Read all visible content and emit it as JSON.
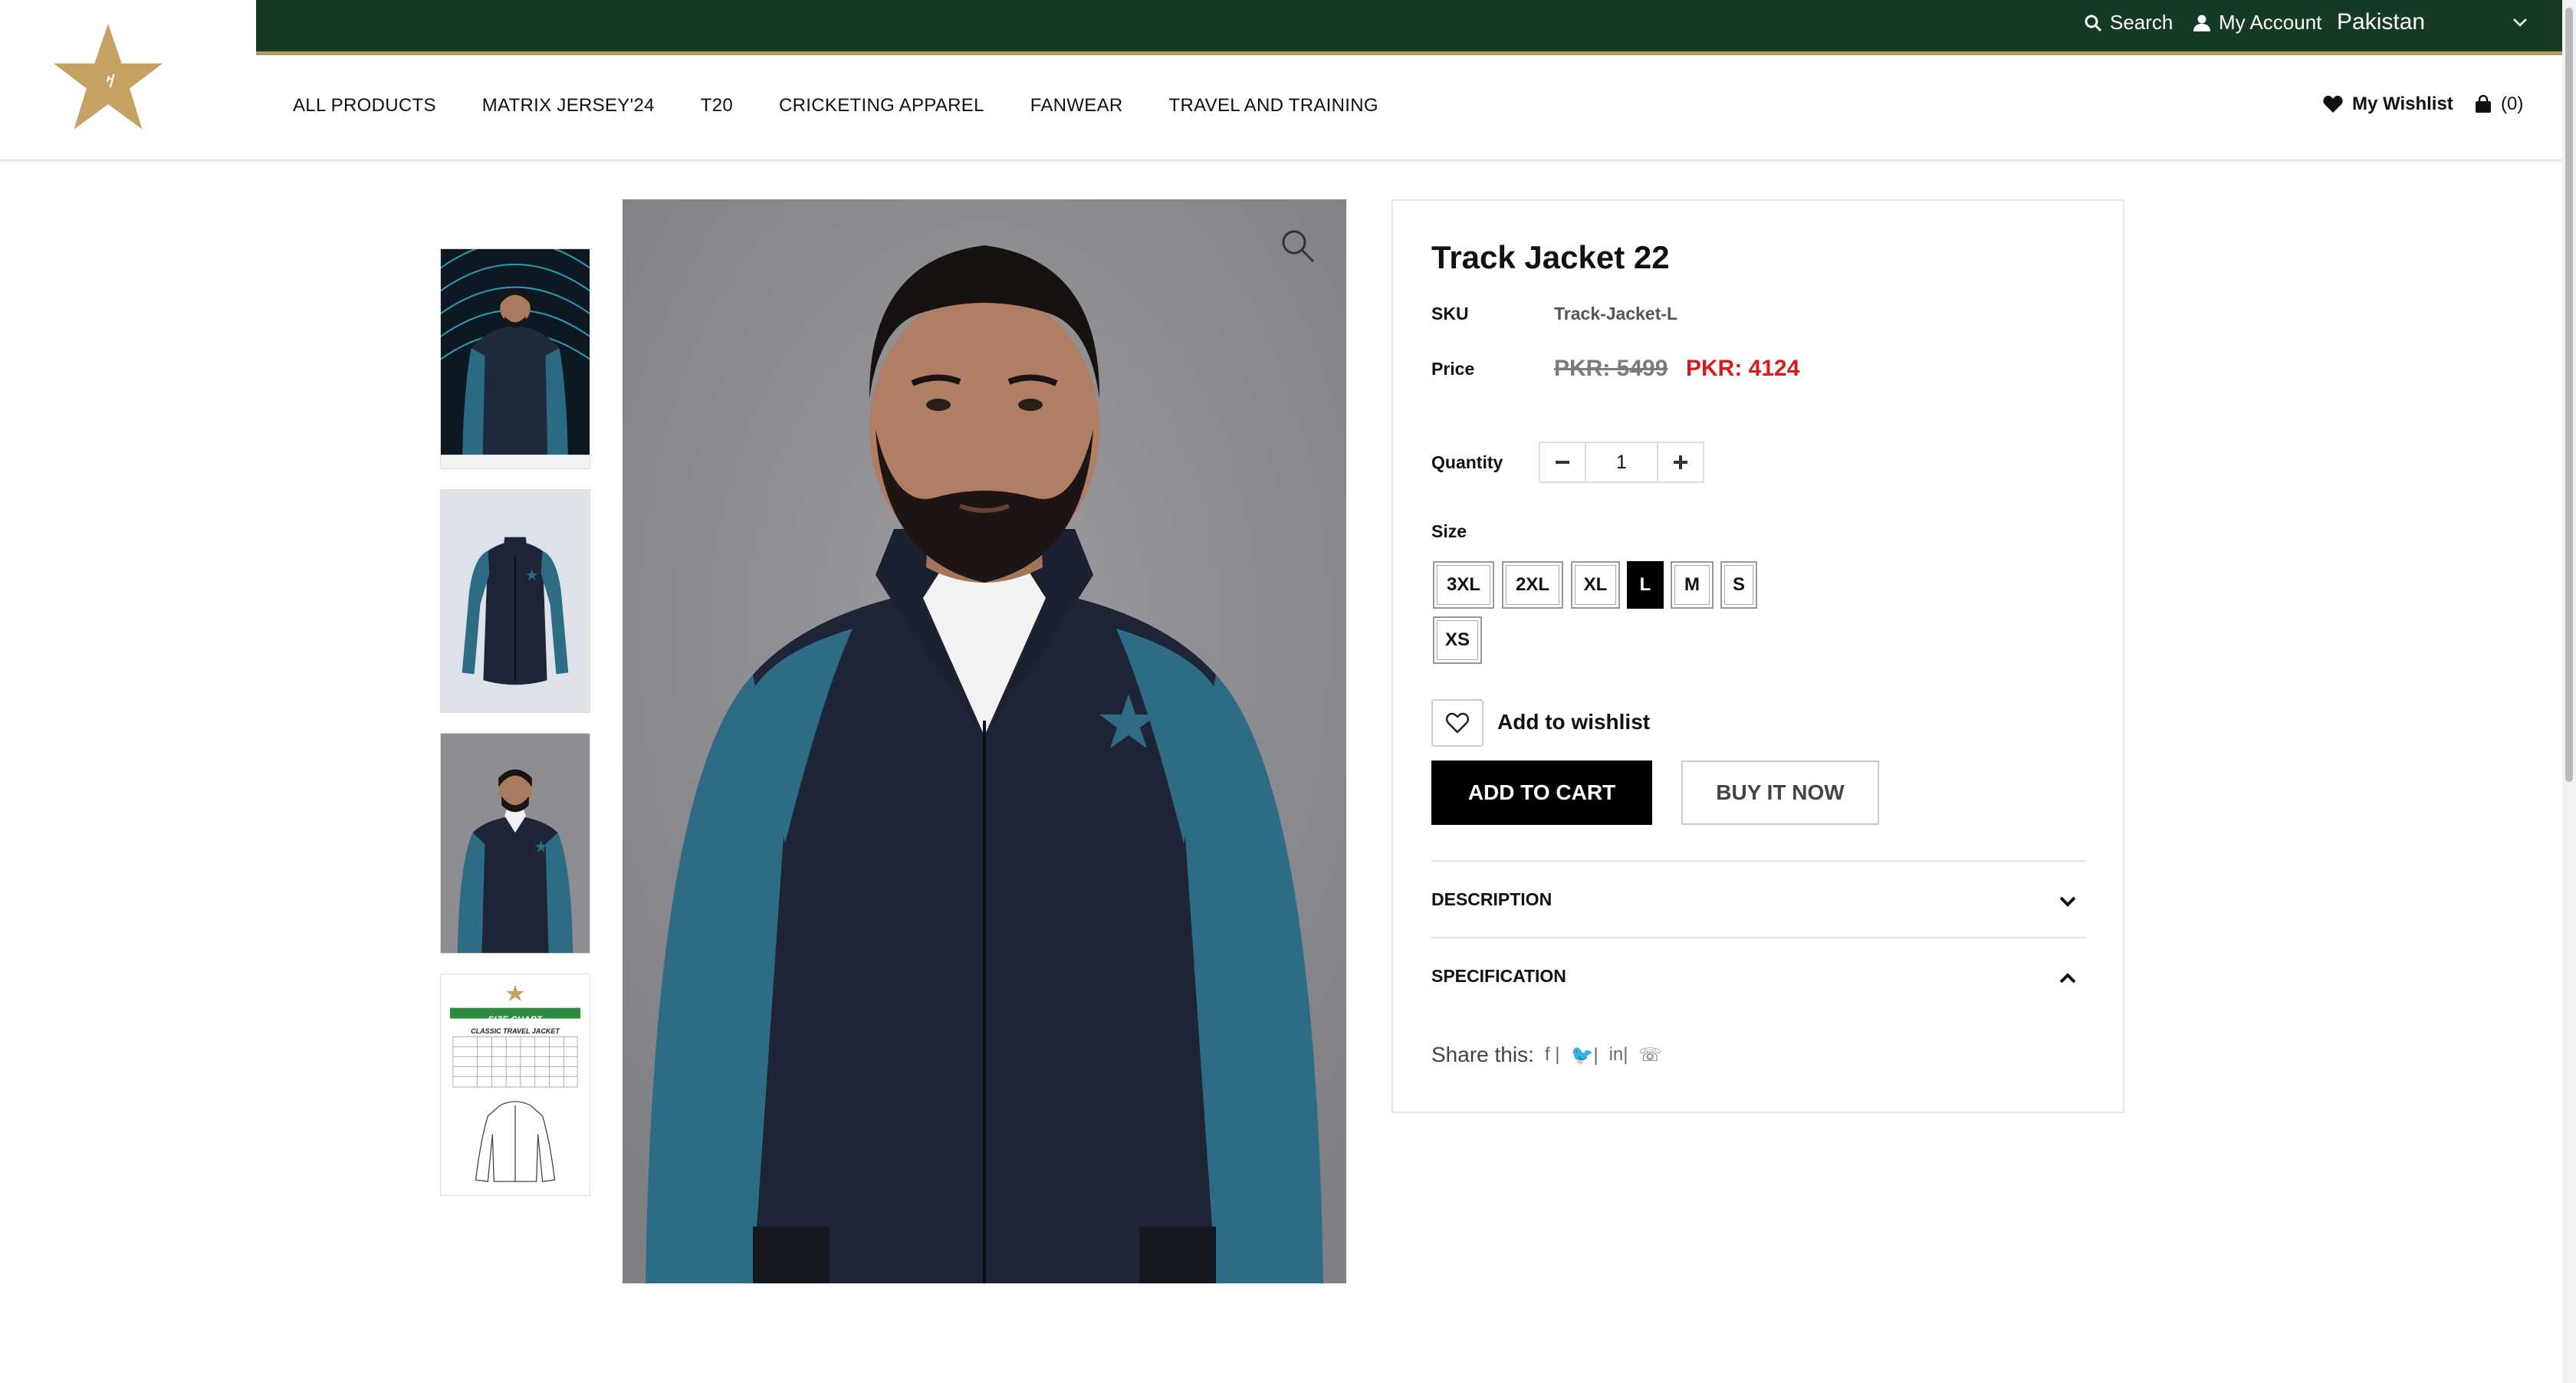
{
  "topbar": {
    "search_label": "Search",
    "account_label": "My Account",
    "country": "Pakistan"
  },
  "nav": {
    "items": [
      "ALL PRODUCTS",
      "MATRIX JERSEY'24",
      "T20",
      "CRICKETING APPAREL",
      "FANWEAR",
      "TRAVEL AND TRAINING"
    ],
    "wishlist_label": "My Wishlist",
    "cart_count": "(0)"
  },
  "product": {
    "title": "Track Jacket 22",
    "sku_label": "SKU",
    "sku_value": "Track-Jacket-L",
    "price_label": "Price",
    "price_old": "PKR:  5499",
    "price_new": "PKR:  4124",
    "quantity_label": "Quantity",
    "quantity_value": "1",
    "size_label": "Size",
    "sizes": [
      "3XL",
      "2XL",
      "XL",
      "L",
      "M",
      "S",
      "XS"
    ],
    "selected_size": "L",
    "wishlist_label": "Add to wishlist",
    "add_to_cart_label": "ADD TO CART",
    "buy_now_label": "BUY IT NOW",
    "description_label": "DESCRIPTION",
    "specification_label": "SPECIFICATION",
    "share_label": "Share this:"
  },
  "size_chart": {
    "title": "SIZE CHART",
    "subtitle": "CLASSIC TRAVEL JACKET"
  },
  "colors": {
    "topbar_bg": "#153a25",
    "gold": "#b59b5a",
    "sale_price": "#d41e1e",
    "jacket_navy": "#1e2536",
    "jacket_teal": "#2e6c86"
  }
}
